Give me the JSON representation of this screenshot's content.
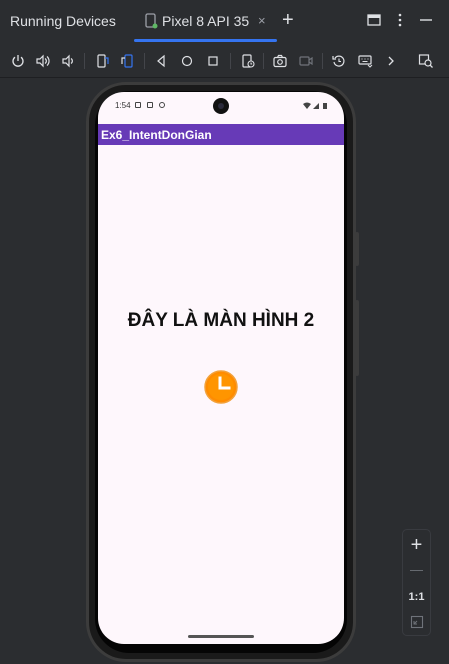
{
  "panel": {
    "title": "Running Devices"
  },
  "tab": {
    "label": "Pixel 8 API 35",
    "close": "×",
    "new_tab": "+"
  },
  "toolbar": {
    "icons": [
      "power-icon",
      "volume-up-icon",
      "volume-down-icon",
      "rotate-left-icon",
      "rotate-right-icon",
      "back-icon",
      "home-icon",
      "overview-icon",
      "snapshot-icon",
      "screenshot-icon",
      "screen-record-icon",
      "reset-icon",
      "keyboard-icon",
      "more-chevron-icon",
      "layout-inspector-icon"
    ]
  },
  "device": {
    "status_time": "1:54",
    "app_title": "Ex6_IntentDonGian",
    "heading": "ĐÂY LÀ MÀN HÌNH 2"
  },
  "zoom": {
    "zoom_in": "+",
    "zoom_out": "—",
    "actual_size": "1:1"
  },
  "colors": {
    "accent": "#3574f0",
    "app_bar": "#673ab7",
    "screen_bg": "#fef7fc",
    "clock": "#ff8c00"
  }
}
